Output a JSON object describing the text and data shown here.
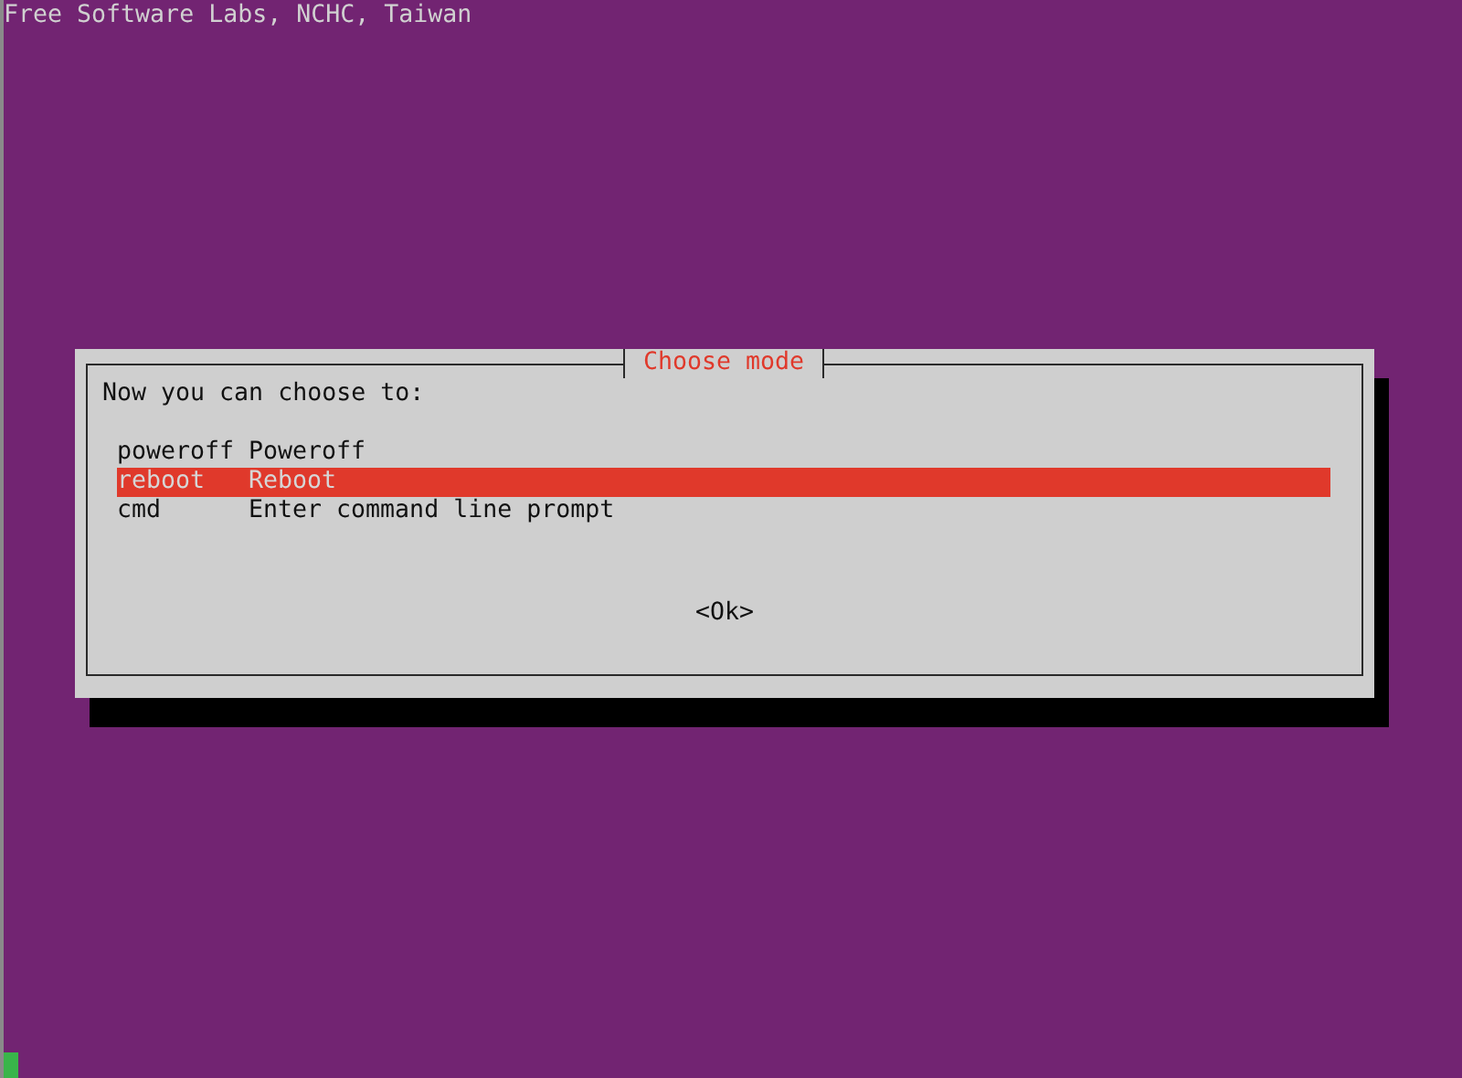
{
  "header": "Free Software Labs, NCHC, Taiwan",
  "dialog": {
    "title": "Choose mode",
    "prompt": "Now you can choose to:",
    "items": [
      {
        "tag": "poweroff",
        "description": "Poweroff",
        "selected": false
      },
      {
        "tag": "reboot",
        "description": "Reboot",
        "selected": true
      },
      {
        "tag": "cmd",
        "description": "Enter command line prompt",
        "selected": false
      }
    ],
    "buttons": [
      "<Ok>"
    ]
  }
}
